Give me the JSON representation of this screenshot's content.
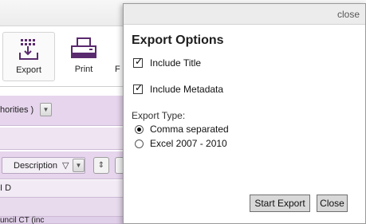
{
  "toolbar": {
    "export_label": "Export",
    "print_label": "Print",
    "partial_label": "F"
  },
  "grid": {
    "authorities_text": "horities )",
    "description_label": "Description",
    "sort_symbol": "▽",
    "up_down_symbol": "⇕",
    "id_header": "I D",
    "bottom_row_text": "uncil CT (inc"
  },
  "dialog": {
    "close_link": "close",
    "title": "Export Options",
    "options": [
      {
        "label": "Include Title",
        "checked": true
      },
      {
        "label": "Include Metadata",
        "checked": true
      }
    ],
    "export_type_label": "Export Type:",
    "export_types": [
      {
        "label": "Comma separated",
        "selected": true
      },
      {
        "label": "Excel 2007 - 2010",
        "selected": false
      }
    ],
    "start_export_label": "Start Export",
    "close_button_label": "Close"
  },
  "colors": {
    "band": "#e6d5ec",
    "icon_purple": "#5a2a6e",
    "dialog_header": "#ececec",
    "button_bg": "#d8d8d8"
  },
  "icons": [
    "export-icon",
    "printer-icon",
    "dropdown-arrow-icon",
    "sort-icon"
  ]
}
